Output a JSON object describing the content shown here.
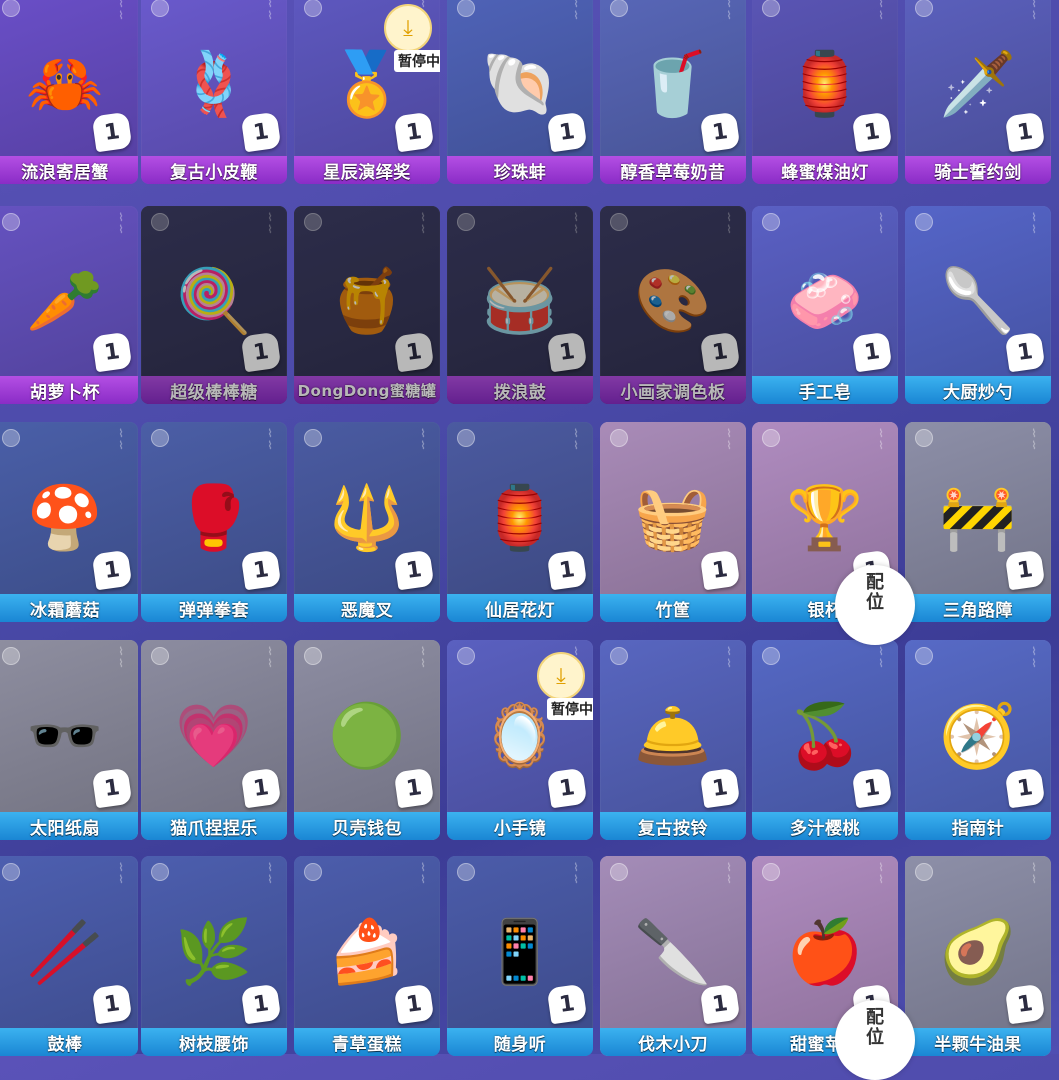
{
  "paused_text": "暂停中",
  "overlay_text": "配\n位",
  "colors": {
    "purple_label": "#9b3bd6",
    "blue_label": "#2a9ce4",
    "count_badge": "#ffffff"
  },
  "rows": [
    [
      {
        "name": "流浪寄居蟹",
        "count": "1",
        "label": "purple",
        "icon": "hermit-crab-icon",
        "glyph": "🦀",
        "bg": "#6a4fc8"
      },
      {
        "name": "复古小皮鞭",
        "count": "1",
        "label": "purple",
        "icon": "whip-icon",
        "glyph": "🪢",
        "bg": "#6a5acd"
      },
      {
        "name": "星辰演绎奖",
        "count": "1",
        "label": "purple",
        "icon": "trophy-icon",
        "glyph": "🏅",
        "bg": "#5e58c0",
        "paused": true
      },
      {
        "name": "珍珠蚌",
        "count": "1",
        "label": "purple",
        "icon": "pearl-clam-icon",
        "glyph": "🐚",
        "bg": "#4f63b8"
      },
      {
        "name": "醇香草莓奶昔",
        "count": "1",
        "label": "purple",
        "icon": "milkshake-icon",
        "glyph": "🥤",
        "bg": "#5867b8"
      },
      {
        "name": "蜂蜜煤油灯",
        "count": "1",
        "label": "purple",
        "icon": "lantern-icon",
        "glyph": "🏮",
        "bg": "#5a55b5"
      },
      {
        "name": "骑士誓约剑",
        "count": "1",
        "label": "purple",
        "icon": "sword-icon",
        "glyph": "🗡️",
        "bg": "#5b60bd"
      }
    ],
    [
      {
        "name": "胡萝卜杯",
        "count": "1",
        "label": "purple",
        "icon": "carrot-cup-icon",
        "glyph": "🥕",
        "bg": "#6552c0"
      },
      {
        "name": "超级棒棒糖",
        "count": "1",
        "label": "purple",
        "icon": "lollipop-icon",
        "glyph": "🍭",
        "bg": "#3e3e66",
        "dim": true
      },
      {
        "name": "DongDong蜜糖罐",
        "count": "1",
        "label": "purple",
        "icon": "honey-pot-icon",
        "glyph": "🍯",
        "bg": "#3e3e66",
        "dim": true
      },
      {
        "name": "拨浪鼓",
        "count": "1",
        "label": "purple",
        "icon": "rattle-drum-icon",
        "glyph": "🥁",
        "bg": "#3e3e66",
        "dim": true
      },
      {
        "name": "小画家调色板",
        "count": "1",
        "label": "purple",
        "icon": "palette-icon",
        "glyph": "🎨",
        "bg": "#3e3e66",
        "dim": true
      },
      {
        "name": "手工皂",
        "count": "1",
        "label": "blue",
        "icon": "soap-icon",
        "glyph": "🧼",
        "bg": "#5a60c4"
      },
      {
        "name": "大厨炒勺",
        "count": "1",
        "label": "blue",
        "icon": "ladle-icon",
        "glyph": "🥄",
        "bg": "#5565c8"
      }
    ],
    [
      {
        "name": "冰霜蘑菇",
        "count": "1",
        "label": "blue",
        "icon": "mushroom-icon",
        "glyph": "🍄",
        "bg": "#4a5fa8"
      },
      {
        "name": "弹弹拳套",
        "count": "1",
        "label": "blue",
        "icon": "boxing-glove-icon",
        "glyph": "🥊",
        "bg": "#4b5ea6"
      },
      {
        "name": "恶魔叉",
        "count": "1",
        "label": "blue",
        "icon": "trident-icon",
        "glyph": "🔱",
        "bg": "#4a5ba2"
      },
      {
        "name": "仙居花灯",
        "count": "1",
        "label": "blue",
        "icon": "flower-lantern-icon",
        "glyph": "🏮",
        "bg": "#4b5aa0"
      },
      {
        "name": "竹筐",
        "count": "1",
        "label": "blue",
        "icon": "bamboo-basket-icon",
        "glyph": "🧺",
        "bg": "#a98bb8"
      },
      {
        "name": "银杯",
        "count": "1",
        "label": "blue",
        "icon": "silver-cup-icon",
        "glyph": "🏆",
        "bg": "#b08cc0"
      },
      {
        "name": "三角路障",
        "count": "1",
        "label": "blue",
        "icon": "traffic-cone-icon",
        "glyph": "🚧",
        "bg": "#8d8fa8"
      }
    ],
    [
      {
        "name": "太阳纸扇",
        "count": "1",
        "label": "blue",
        "icon": "sunglasses-icon",
        "glyph": "🕶️",
        "bg": "#8e8ea0"
      },
      {
        "name": "猫爪捏捏乐",
        "count": "1",
        "label": "blue",
        "icon": "heart-glasses-icon",
        "glyph": "💗",
        "bg": "#8c8ca0"
      },
      {
        "name": "贝壳钱包",
        "count": "1",
        "label": "blue",
        "icon": "shell-wallet-icon",
        "glyph": "🟢",
        "bg": "#8d8da2"
      },
      {
        "name": "小手镜",
        "count": "1",
        "label": "blue",
        "icon": "hand-mirror-icon",
        "glyph": "🪞",
        "bg": "#5a60c0",
        "paused": true
      },
      {
        "name": "复古按铃",
        "count": "1",
        "label": "blue",
        "icon": "bell-icon",
        "glyph": "🛎️",
        "bg": "#5866c0"
      },
      {
        "name": "多汁樱桃",
        "count": "1",
        "label": "blue",
        "icon": "cherry-icon",
        "glyph": "🍒",
        "bg": "#5568c4"
      },
      {
        "name": "指南针",
        "count": "1",
        "label": "blue",
        "icon": "compass-icon",
        "glyph": "🧭",
        "bg": "#576ac6"
      }
    ],
    [
      {
        "name": "鼓棒",
        "count": "1",
        "label": "blue",
        "icon": "drumstick-icon",
        "glyph": "🥢",
        "bg": "#4d5fb0"
      },
      {
        "name": "树枝腰饰",
        "count": "1",
        "label": "blue",
        "icon": "branch-icon",
        "glyph": "🌿",
        "bg": "#4c5eae"
      },
      {
        "name": "青草蛋糕",
        "count": "1",
        "label": "blue",
        "icon": "cake-icon",
        "glyph": "🍰",
        "bg": "#4c5dac"
      },
      {
        "name": "随身听",
        "count": "1",
        "label": "blue",
        "icon": "music-player-icon",
        "glyph": "📱",
        "bg": "#4b5caa"
      },
      {
        "name": "伐木小刀",
        "count": "1",
        "label": "blue",
        "icon": "knife-icon",
        "glyph": "🔪",
        "bg": "#a48cb8"
      },
      {
        "name": "甜蜜苹果",
        "count": "1",
        "label": "blue",
        "icon": "apple-icon",
        "glyph": "🍎",
        "bg": "#b08cc0"
      },
      {
        "name": "半颗牛油果",
        "count": "1",
        "label": "blue",
        "icon": "avocado-icon",
        "glyph": "🥑",
        "bg": "#8d8fa8"
      }
    ]
  ]
}
